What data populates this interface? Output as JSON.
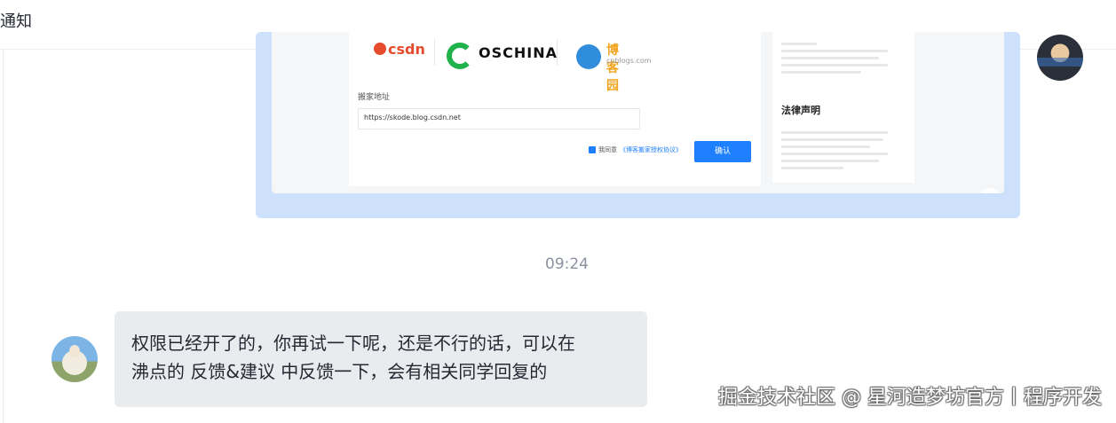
{
  "header": {
    "title": "通知"
  },
  "screenshot": {
    "logos": {
      "csdn": "csdn",
      "oschina": "OSCHINA",
      "cnblogs": "博客园",
      "cnblogs_sub": "cnblogs.com"
    },
    "field_label": "搬家地址",
    "field_value": "https://skode.blog.csdn.net",
    "agree_text": "我同意",
    "agree_link": "《博客搬家授权协议》",
    "confirm_button": "确认",
    "side_title": "法律声明"
  },
  "time_separator": "09:24",
  "message": {
    "text_line1": "权限已经开了的，你再试一下呢，还是不行的话，可以在",
    "text_line2": "沸点的 反馈&建议 中反馈一下，会有相关同学回复的"
  },
  "watermark": "掘金技术社区 @ 星河造梦坊官方丨程序开发",
  "colors": {
    "bubble_self": "#cde1fc",
    "bubble_other": "#e9ebee",
    "accent": "#1e80ff"
  }
}
